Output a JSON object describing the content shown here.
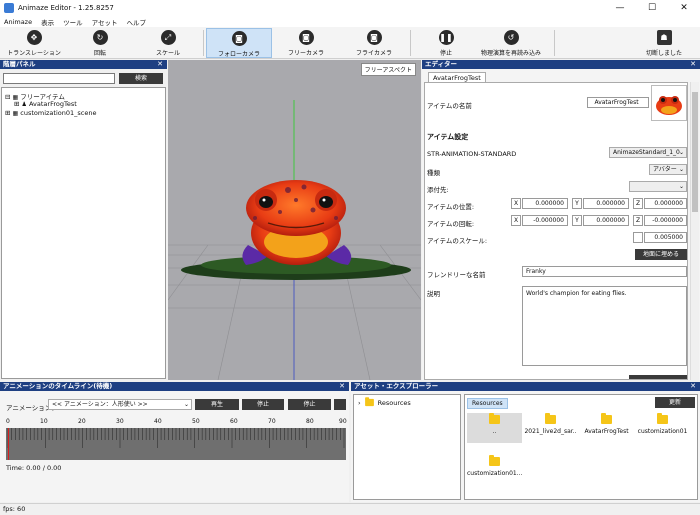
{
  "window": {
    "title": "Animaze Editor - 1.25.8257",
    "min": "—",
    "max": "☐",
    "close": "✕"
  },
  "menu": [
    "Animaze",
    "表示",
    "ツール",
    "アセット",
    "ヘルプ"
  ],
  "toolbar": {
    "items": [
      {
        "label": "トランスレーション",
        "icon": "move-icon"
      },
      {
        "label": "回転",
        "icon": "rotate-icon"
      },
      {
        "label": "スケール",
        "icon": "scale-icon"
      },
      {
        "label": "フォローカメラ",
        "icon": "camera-icon"
      },
      {
        "label": "フリーカメラ",
        "icon": "camera-icon"
      },
      {
        "label": "フライカメラ",
        "icon": "camera-icon"
      },
      {
        "label": "停止",
        "icon": "pause-icon"
      },
      {
        "label": "物理演算を再読み込み",
        "icon": "reload-icon"
      },
      {
        "label": "切断しました",
        "icon": "disconnected-icon"
      }
    ]
  },
  "hierarchy": {
    "title": "階層パネル",
    "search_button": "検索",
    "search_value": "",
    "items": [
      "フリーアイテム",
      "AvatarFrogTest",
      "customization01_scene"
    ]
  },
  "viewport": {
    "badge": "フリーアスペクト"
  },
  "editor": {
    "title": "エディター",
    "tab": "AvatarFrogTest",
    "item_name_label": "アイテムの名前",
    "item_name_value": "AvatarFrogTest",
    "settings_heading": "アイテム設定",
    "anim_label": "STR-ANIMATION-STANDARD",
    "anim_value": "AnimazeStandard_1_0",
    "type_label": "種類",
    "type_value": "アバター",
    "attach_label": "添付先:",
    "pos_label": "アイテムの位置:",
    "pos": [
      "0.000000",
      "0.000000",
      "0.000000"
    ],
    "rot_label": "アイテムの回転:",
    "rot": [
      "-0.000000",
      "0.000000",
      "-0.000000"
    ],
    "scale_label": "アイテムのスケール:",
    "scale_value": "0.005000",
    "ground_button": "地面に埋める",
    "friendly_label": "フレンドリーな名前",
    "friendly_value": "Franky",
    "desc_label": "説明",
    "desc_value": "World's champion for eating flies.",
    "axes": [
      "X",
      "Y",
      "Z"
    ]
  },
  "timeline": {
    "title": "アニメーションのタイムライン(待機)",
    "anim_label": "アニメーション：",
    "anim_select": "<< アニメーション：人形使い >>",
    "play": "再生",
    "stop1": "停止",
    "stop2": "停止",
    "ticks": [
      "0",
      "10",
      "20",
      "30",
      "40",
      "50",
      "60",
      "70",
      "80",
      "90"
    ],
    "time": "Time: 0.00 / 0.00"
  },
  "assets": {
    "title": "アセット・エクスプローラー",
    "tree_root": "Resources",
    "breadcrumb": "Resources",
    "refresh": "更新",
    "files": [
      "..",
      "2021_live2d_sar..",
      "AvatarFrogTest",
      "customization01",
      "customization01..."
    ]
  },
  "status": {
    "fps": "fps: 60"
  },
  "colors": {
    "panel_header": "#1e3f82",
    "accent": "#2b2b2b",
    "active_tool": "#cfe3f7",
    "timeline_red": "#d82020"
  }
}
